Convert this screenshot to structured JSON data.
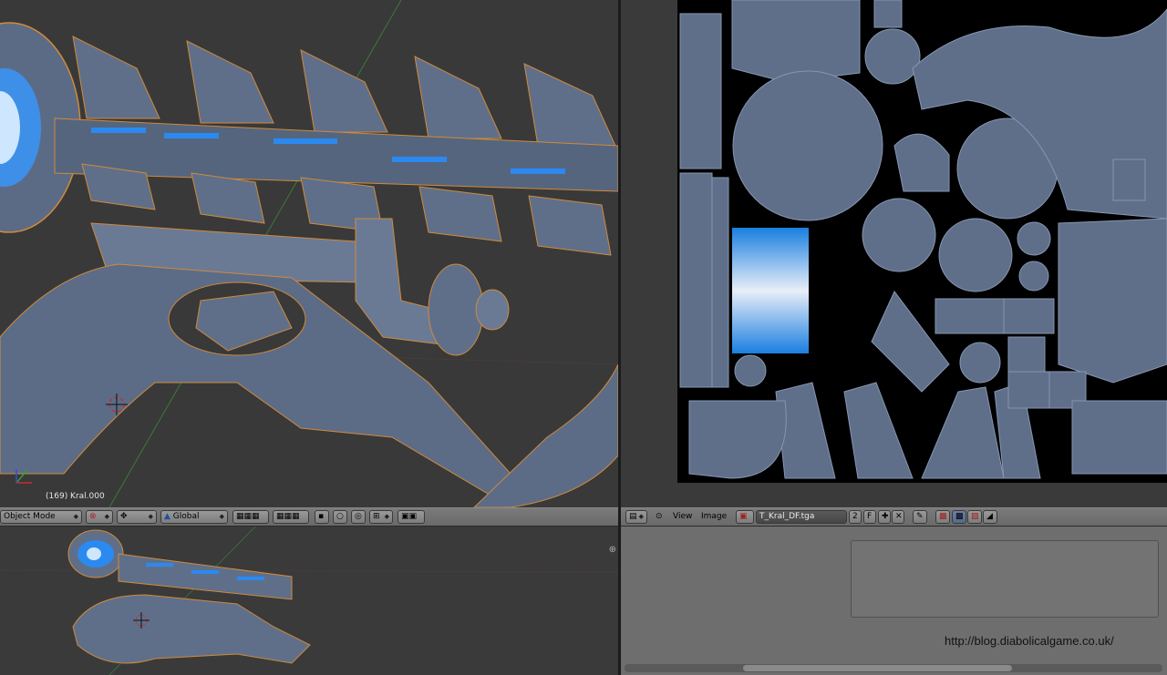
{
  "viewport3d": {
    "object_label": "(169) Kral.000",
    "mode": "Object Mode",
    "orientation": "Global"
  },
  "image_editor": {
    "menu_view": "View",
    "menu_image": "Image",
    "image_name": "T_Kral_DF.tga",
    "users": "2",
    "fake_user": "F"
  },
  "watermark": "http://blog.diabolicalgame.co.uk/",
  "colors": {
    "mesh": "#5f6f8a",
    "outline": "#d08a3a",
    "emissive_blue": "#1a7fe0",
    "uv_background": "#000000",
    "viewport_bg": "#393939",
    "header_bg": "#727272"
  },
  "icons": [
    "viewport-shading-icon",
    "pivot-icon",
    "manipulator-icon",
    "layers-icon",
    "render-icon",
    "image-icon",
    "new-icon",
    "close-icon",
    "pin-icon",
    "checker-icon"
  ]
}
